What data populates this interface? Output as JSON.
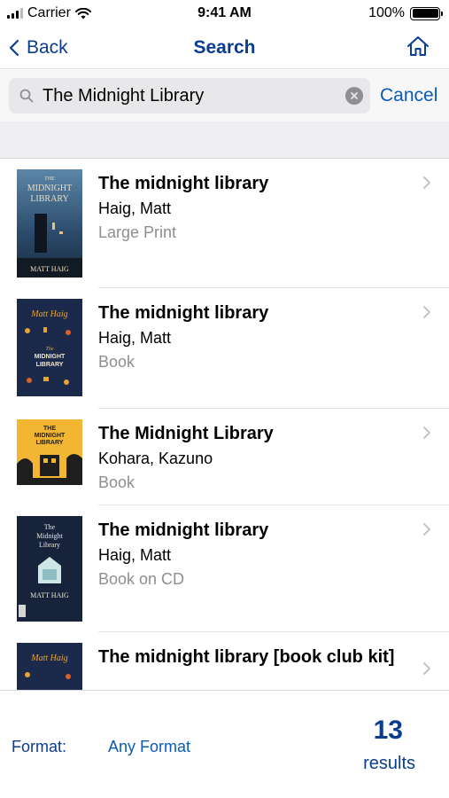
{
  "status_bar": {
    "carrier": "Carrier",
    "time": "9:41 AM",
    "battery": "100%"
  },
  "nav": {
    "back_label": "Back",
    "title": "Search",
    "home_icon": "home-icon"
  },
  "search": {
    "value": "The Midnight Library",
    "cancel_label": "Cancel"
  },
  "results": [
    {
      "title": "The midnight library",
      "author": "Haig, Matt",
      "format": "Large Print",
      "cover": {
        "bg": "#1d3550",
        "accent": "#c9a97a",
        "top_text": "THE MIDNIGHT LIBRARY",
        "bottom_text": "MATT HAIG"
      }
    },
    {
      "title": "The midnight library",
      "author": "Haig, Matt",
      "format": "Book",
      "cover": {
        "bg": "#1b2a4a",
        "accent": "#e6a437",
        "top_text": "Matt Haig",
        "bottom_text": "The MIDNIGHT LIBRARY"
      }
    },
    {
      "title": "The Midnight Library",
      "author": "Kohara, Kazuno",
      "format": "Book",
      "cover": {
        "bg": "#f2b632",
        "accent": "#1e1e1e",
        "top_text": "THE MIDNIGHT LIBRARY",
        "bottom_text": "Kazuno Kohara"
      }
    },
    {
      "title": "The midnight library",
      "author": "Haig, Matt",
      "format": "Book on CD",
      "cover": {
        "bg": "#16233b",
        "accent": "#cfe6e8",
        "top_text": "The Midnight Library",
        "bottom_text": "MATT HAIG"
      }
    },
    {
      "title": "The midnight library [book club kit]",
      "author": "",
      "format": "",
      "cover": {
        "bg": "#1b2a4a",
        "accent": "#e6a437",
        "top_text": "Matt Haig",
        "bottom_text": ""
      }
    }
  ],
  "footer": {
    "format_label": "Format:",
    "format_value": "Any Format",
    "results_count": "13",
    "results_label": "results"
  },
  "colors": {
    "brand_navy": "#0a3d91",
    "link_blue": "#0a5bb5"
  }
}
